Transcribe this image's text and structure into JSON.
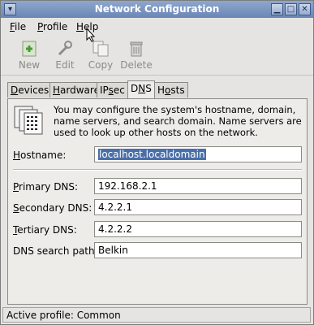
{
  "window": {
    "title": "Network Configuration",
    "menu_glyph": "▾",
    "minimize_glyph": "▁",
    "maximize_glyph": "□",
    "close_glyph": "✕"
  },
  "menubar": {
    "items": [
      {
        "access": "F",
        "rest": "ile"
      },
      {
        "access": "P",
        "rest": "rofile"
      },
      {
        "access": "H",
        "rest": "elp"
      }
    ]
  },
  "toolbar": {
    "new_label": "New",
    "edit_label": "Edit",
    "copy_label": "Copy",
    "delete_label": "Delete"
  },
  "tabs": [
    {
      "access": "D",
      "rest": "evices"
    },
    {
      "access": "H",
      "rest": "ardware"
    },
    {
      "pre": "IP",
      "access": "s",
      "rest": "ec"
    },
    {
      "pre": "D",
      "access": "N",
      "rest": "S"
    },
    {
      "pre": "H",
      "access": "o",
      "rest": "sts"
    }
  ],
  "dns": {
    "info_text": "You may configure the system's hostname, domain, name servers, and search domain. Name servers are used to look up other hosts on the network.",
    "hostname": {
      "access": "H",
      "rest": "ostname:",
      "value": "localhost.localdomain"
    },
    "primary": {
      "access": "P",
      "rest": "rimary DNS:",
      "value": "192.168.2.1"
    },
    "secondary": {
      "access": "S",
      "rest": "econdary DNS:",
      "value": "4.2.2.1"
    },
    "tertiary": {
      "access": "T",
      "rest": "ertiary DNS:",
      "value": "4.2.2.2"
    },
    "search": {
      "label": "DNS search path:",
      "value": "Belkin"
    }
  },
  "status": {
    "text": "Active profile: Common"
  },
  "colors": {
    "titlebar": "#6a86b6",
    "selection": "#4a6ea8",
    "disabled_text": "#8c8a88"
  }
}
